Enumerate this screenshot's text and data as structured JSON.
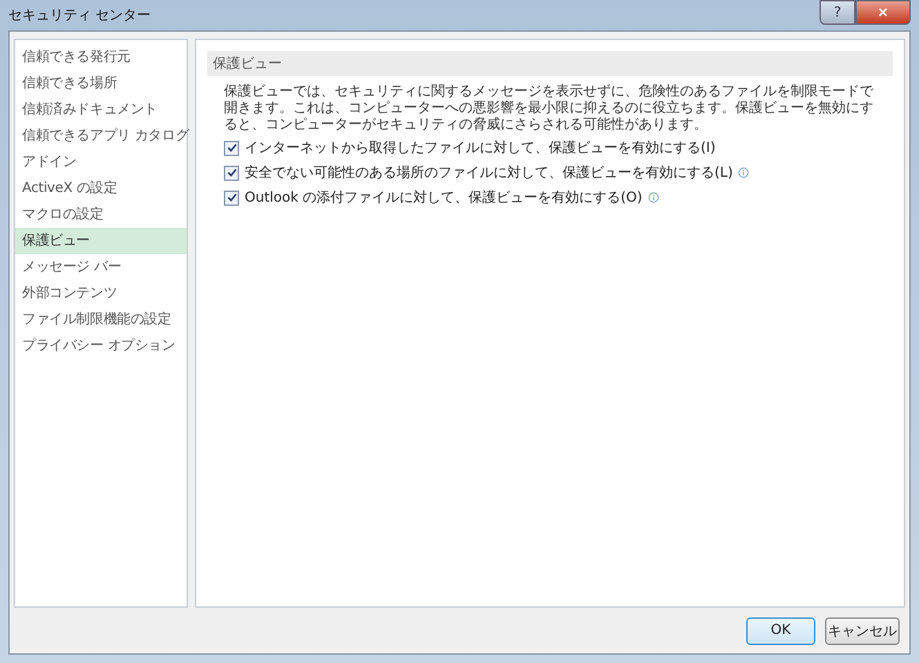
{
  "window": {
    "title": "セキュリティ センター",
    "help": "?",
    "close": "×"
  },
  "sidebar": {
    "items": [
      {
        "label": "信頼できる発行元",
        "selected": false
      },
      {
        "label": "信頼できる場所",
        "selected": false
      },
      {
        "label": "信頼済みドキュメント",
        "selected": false
      },
      {
        "label": "信頼できるアプリ カタログ",
        "selected": false
      },
      {
        "label": "アドイン",
        "selected": false
      },
      {
        "label": "ActiveX の設定",
        "selected": false
      },
      {
        "label": "マクロの設定",
        "selected": false
      },
      {
        "label": "保護ビュー",
        "selected": true
      },
      {
        "label": "メッセージ バー",
        "selected": false
      },
      {
        "label": "外部コンテンツ",
        "selected": false
      },
      {
        "label": "ファイル制限機能の設定",
        "selected": false
      },
      {
        "label": "プライバシー オプション",
        "selected": false
      }
    ]
  },
  "section": {
    "title": "保護ビュー",
    "description": "保護ビューでは、セキュリティに関するメッセージを表示せずに、危険性のあるファイルを制限モードで開きます。これは、コンピューターへの悪影響を最小限に抑えるのに役立ちます。保護ビューを無効にすると、コンピューターがセキュリティの脅威にさらされる可能性があります。",
    "options": [
      {
        "label": "インターネットから取得したファイルに対して、保護ビューを有効にする(I)",
        "checked": true,
        "info": false
      },
      {
        "label": "安全でない可能性のある場所のファイルに対して、保護ビューを有効にする(L)",
        "checked": true,
        "info": true
      },
      {
        "label": "Outlook の添付ファイルに対して、保護ビューを有効にする(O)",
        "checked": true,
        "info": true
      }
    ]
  },
  "buttons": [
    {
      "label": "OK",
      "kind": "default"
    },
    {
      "label": "キャンセル",
      "kind": "normal"
    }
  ]
}
